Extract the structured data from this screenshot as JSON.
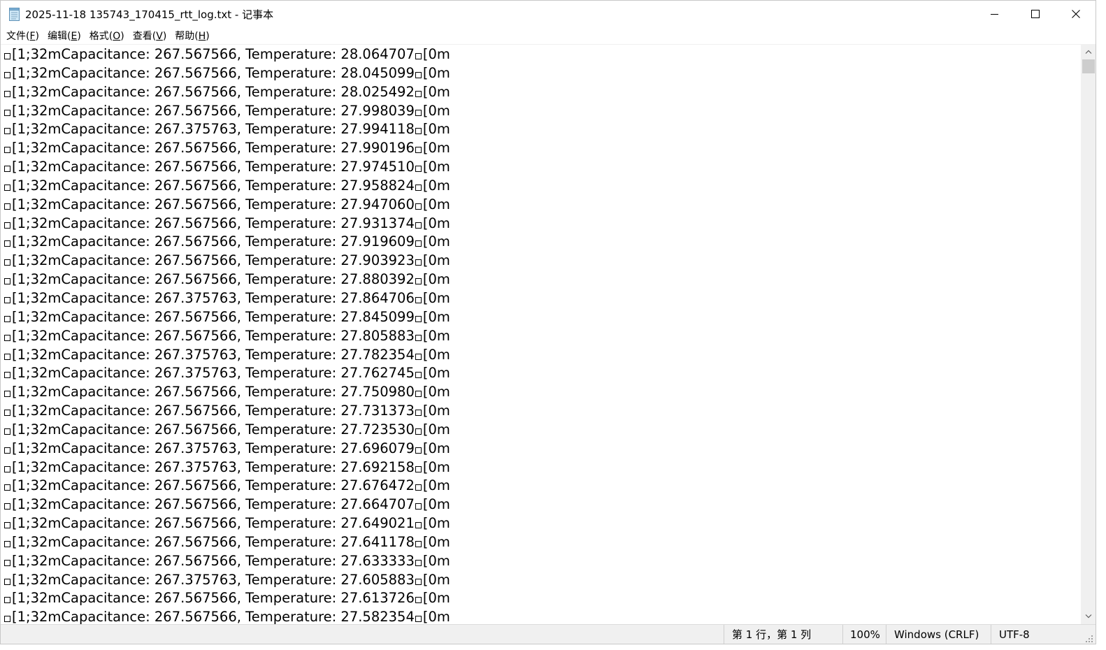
{
  "window": {
    "title": "2025-11-18 135743_170415_rtt_log.txt - 记事本",
    "icon": "notepad-icon"
  },
  "menu": [
    {
      "label": "文件(",
      "accel": "F",
      "suffix": ")"
    },
    {
      "label": "编辑(",
      "accel": "E",
      "suffix": ")"
    },
    {
      "label": "格式(",
      "accel": "O",
      "suffix": ")"
    },
    {
      "label": "查看(",
      "accel": "V",
      "suffix": ")"
    },
    {
      "label": "帮助(",
      "accel": "H",
      "suffix": ")"
    }
  ],
  "editor": {
    "line_prefix": "[1;32m",
    "line_suffix": "[0m",
    "lines": [
      "Capacitance: 267.567566, Temperature: 28.064707",
      "Capacitance: 267.567566, Temperature: 28.045099",
      "Capacitance: 267.567566, Temperature: 28.025492",
      "Capacitance: 267.567566, Temperature: 27.998039",
      "Capacitance: 267.375763, Temperature: 27.994118",
      "Capacitance: 267.567566, Temperature: 27.990196",
      "Capacitance: 267.567566, Temperature: 27.974510",
      "Capacitance: 267.567566, Temperature: 27.958824",
      "Capacitance: 267.567566, Temperature: 27.947060",
      "Capacitance: 267.567566, Temperature: 27.931374",
      "Capacitance: 267.567566, Temperature: 27.919609",
      "Capacitance: 267.567566, Temperature: 27.903923",
      "Capacitance: 267.567566, Temperature: 27.880392",
      "Capacitance: 267.375763, Temperature: 27.864706",
      "Capacitance: 267.567566, Temperature: 27.845099",
      "Capacitance: 267.567566, Temperature: 27.805883",
      "Capacitance: 267.375763, Temperature: 27.782354",
      "Capacitance: 267.375763, Temperature: 27.762745",
      "Capacitance: 267.567566, Temperature: 27.750980",
      "Capacitance: 267.567566, Temperature: 27.731373",
      "Capacitance: 267.567566, Temperature: 27.723530",
      "Capacitance: 267.375763, Temperature: 27.696079",
      "Capacitance: 267.375763, Temperature: 27.692158",
      "Capacitance: 267.567566, Temperature: 27.676472",
      "Capacitance: 267.567566, Temperature: 27.664707",
      "Capacitance: 267.567566, Temperature: 27.649021",
      "Capacitance: 267.567566, Temperature: 27.641178",
      "Capacitance: 267.567566, Temperature: 27.633333",
      "Capacitance: 267.375763, Temperature: 27.605883",
      "Capacitance: 267.567566, Temperature: 27.613726",
      "Capacitance: 267.567566, Temperature: 27.582354"
    ]
  },
  "status": {
    "position": "第 1 行，第 1 列",
    "zoom": "100%",
    "line_ending": "Windows (CRLF)",
    "encoding": "UTF-8"
  },
  "colors": {
    "statusbar_bg": "#f0f0f0",
    "scrollbar_bg": "#f0f0f0",
    "scroll_thumb": "#cdcdcd",
    "text": "#000000"
  }
}
